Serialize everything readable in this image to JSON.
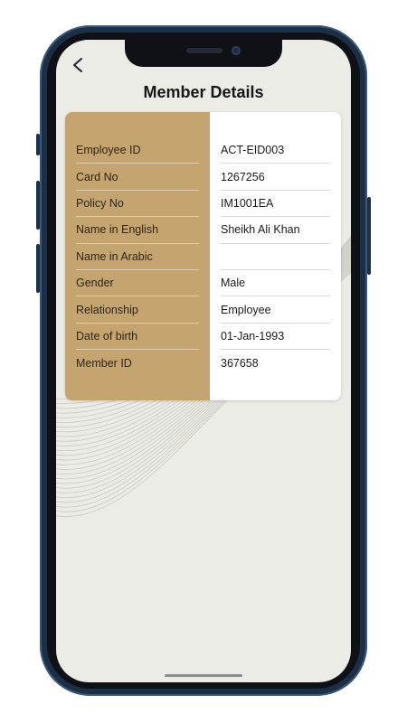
{
  "page": {
    "title": "Member Details"
  },
  "member_details": [
    {
      "label": "Employee ID",
      "value": "ACT-EID003"
    },
    {
      "label": "Card No",
      "value": "1267256"
    },
    {
      "label": "Policy No",
      "value": "IM1001EA"
    },
    {
      "label": "Name in English",
      "value": "Sheikh Ali Khan"
    },
    {
      "label": "Name in Arabic",
      "value": ""
    },
    {
      "label": "Gender",
      "value": "Male"
    },
    {
      "label": "Relationship",
      "value": "Employee"
    },
    {
      "label": "Date of birth",
      "value": "01-Jan-1993"
    },
    {
      "label": "Member ID",
      "value": "367658"
    }
  ],
  "icons": {
    "back": "chevron-left-icon"
  },
  "colors": {
    "label_panel": "#c4a56f",
    "screen_bg": "#ecece6",
    "device_frame": "#1b2f47"
  }
}
